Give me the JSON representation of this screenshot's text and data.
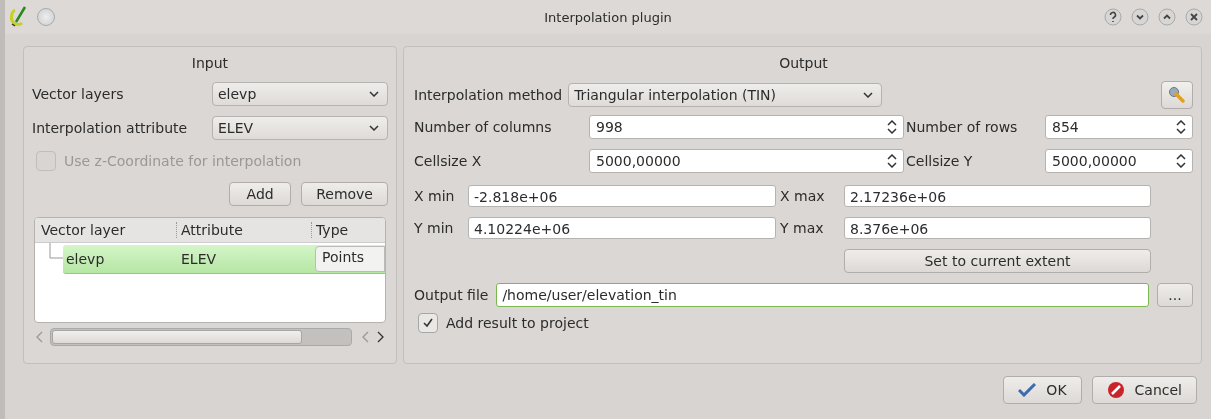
{
  "window": {
    "title": "Interpolation plugin"
  },
  "input": {
    "title": "Input",
    "vector_layers": {
      "label": "Vector layers",
      "value": "elevp"
    },
    "interpolation_attribute": {
      "label": "Interpolation attribute",
      "value": "ELEV"
    },
    "use_z": {
      "label": "Use z-Coordinate for interpolation",
      "checked": false,
      "disabled": true
    },
    "buttons": [
      "Add",
      "Remove"
    ],
    "table": {
      "columns": [
        "Vector layer",
        "Attribute",
        "Type"
      ],
      "rows": [
        {
          "cells": [
            "elevp",
            "ELEV",
            "Points"
          ],
          "selected": true
        }
      ]
    }
  },
  "output": {
    "title": "Output",
    "method": {
      "label": "Interpolation method",
      "value": "Triangular interpolation (TIN)"
    },
    "spins": [
      {
        "label": "Number of columns",
        "value": "998"
      },
      {
        "label": "Number of rows",
        "value": "854"
      },
      {
        "label": "Cellsize X",
        "value": "5000,00000"
      },
      {
        "label": "Cellsize Y",
        "value": "5000,00000"
      }
    ],
    "extent": [
      {
        "label": "X min",
        "value": "-2.818e+06"
      },
      {
        "label": "X max",
        "value": "2.17236e+06"
      },
      {
        "label": "Y min",
        "value": "4.10224e+06"
      },
      {
        "label": "Y max",
        "value": "8.376e+06"
      }
    ],
    "extent_button": "Set to current extent",
    "output_file": {
      "label": "Output file",
      "value": "/home/user/elevation_tin"
    },
    "browse_button": "...",
    "add_result": {
      "label": "Add result to project",
      "checked": true
    }
  },
  "buttons": [
    "OK",
    "Cancel"
  ]
}
